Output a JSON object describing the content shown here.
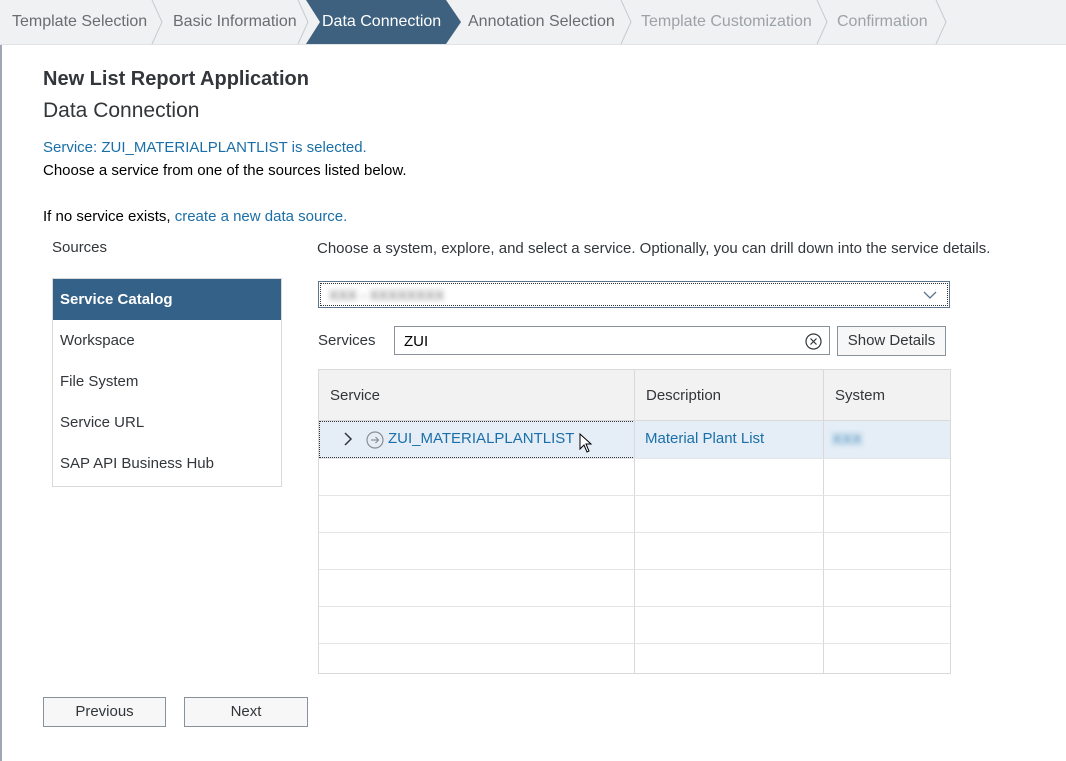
{
  "wizard": {
    "steps": [
      {
        "label": "Template Selection",
        "state": "done"
      },
      {
        "label": "Basic Information",
        "state": "done"
      },
      {
        "label": "Data Connection",
        "state": "active"
      },
      {
        "label": "Annotation Selection",
        "state": "done"
      },
      {
        "label": "Template Customization",
        "state": "future"
      },
      {
        "label": "Confirmation",
        "state": "future"
      }
    ]
  },
  "page": {
    "title": "New List Report Application",
    "subtitle": "Data Connection",
    "selected_message": "Service: ZUI_MATERIALPLANTLIST is selected.",
    "choose_message": "Choose a service from one of the sources listed below.",
    "no_service_prefix": "If no service exists,",
    "no_service_link": "create a new data source."
  },
  "sources": {
    "label": "Sources",
    "items": [
      {
        "label": "Service Catalog",
        "selected": true
      },
      {
        "label": "Workspace",
        "selected": false
      },
      {
        "label": "File System",
        "selected": false
      },
      {
        "label": "Service URL",
        "selected": false
      },
      {
        "label": "SAP API Business Hub",
        "selected": false
      }
    ]
  },
  "main": {
    "instructions": "Choose a system, explore, and select a service. Optionally, you can drill down into the service details.",
    "system_select": {
      "value": "XXX - XXXXXXXX"
    },
    "services_label": "Services",
    "search_value": "ZUI",
    "show_details_label": "Show Details"
  },
  "table": {
    "columns": [
      "Service",
      "Description",
      "System"
    ],
    "rows": [
      {
        "service": "ZUI_MATERIALPLANTLIST",
        "description": "Material Plant List",
        "system": "XXX"
      }
    ]
  },
  "footer": {
    "previous_label": "Previous",
    "next_label": "Next"
  },
  "colors": {
    "active_step": "#3e617f",
    "selected_source": "#346187",
    "link": "#1b6fa8",
    "selected_row": "#e5eef7"
  }
}
